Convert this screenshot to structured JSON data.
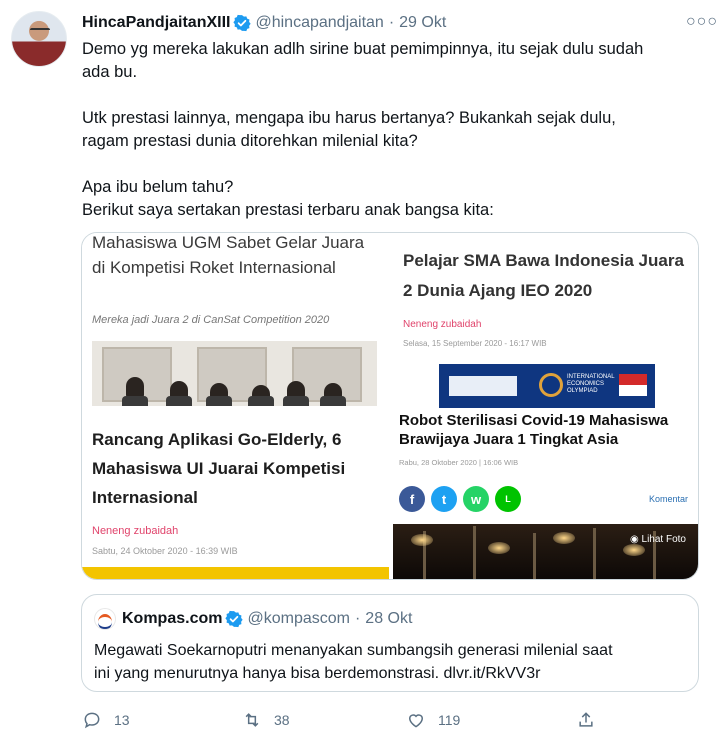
{
  "tweet": {
    "display_name": "HincaPandjaitanXIII",
    "handle": "@hincapandjaitan",
    "separator": "·",
    "time": "29 Okt",
    "more_icon": "more-horizontal-icon",
    "text_lines": [
      "Demo yg mereka lakukan adlh sirine buat pemimpinnya, itu sejak dulu sudah",
      "ada bu.",
      "",
      "Utk prestasi lainnya, mengapa ibu harus bertanya? Bukankah sejak dulu,",
      "ragam prestasi dunia ditorehkan milenial kita?",
      "",
      "Apa ibu belum tahu?",
      "Berikut saya sertakan prestasi terbaru anak bangsa kita:"
    ]
  },
  "media": {
    "left": {
      "headline_top": "Mahasiswa UGM Sabet Gelar Juara di Kompetisi Roket Internasional",
      "subtitle_top": "Mereka jadi Juara 2 di CanSat Competition 2020",
      "headline_bottom": "Rancang Aplikasi Go-Elderly, 6 Mahasiswa UI Juarai Kompetisi Internasional",
      "author": "Neneng zubaidah",
      "date": "Sabtu, 24 Oktober 2020 - 16:39 WIB"
    },
    "right": {
      "headline_top": "Pelajar SMA Bawa Indonesia Juara 2 Dunia Ajang IEO 2020",
      "author": "Neneng zubaidah",
      "date": "Selasa, 15 September 2020 - 16:17 WIB",
      "banner_text": "INTERNATIONAL ECONOMICS OLYMPIAD",
      "headline_bottom": "Robot Sterilisasi Covid-19 Mahasiswa Brawijaya Juara 1 Tingkat Asia",
      "date_bottom": "Rabu, 28 Oktober 2020 | 16:06 WIB",
      "share": [
        {
          "icon": "facebook-icon",
          "glyph": "f",
          "color": "#3b5998"
        },
        {
          "icon": "twitter-icon",
          "glyph": "t",
          "color": "#1da1f2"
        },
        {
          "icon": "whatsapp-icon",
          "glyph": "w",
          "color": "#25d366"
        },
        {
          "icon": "line-icon",
          "glyph": "L",
          "color": "#00c300"
        }
      ],
      "komentar": "Komentar",
      "lihat_foto": "Lihat Foto"
    }
  },
  "quote": {
    "display_name": "Kompas.com",
    "handle": "@kompascom",
    "separator": "·",
    "time": "28 Okt",
    "text_lines": [
      "Megawati Soekarnoputri menanyakan sumbangsih generasi milenial saat",
      "ini yang menurutnya hanya bisa berdemonstrasi. dlvr.it/RkVV3r"
    ]
  },
  "actions": {
    "reply_count": "13",
    "retweet_count": "38",
    "like_count": "119",
    "share_icon": "share-icon"
  },
  "colors": {
    "verified": "#1d9bf0",
    "muted": "#5b7083",
    "kompas_orange": "#e55a22"
  }
}
